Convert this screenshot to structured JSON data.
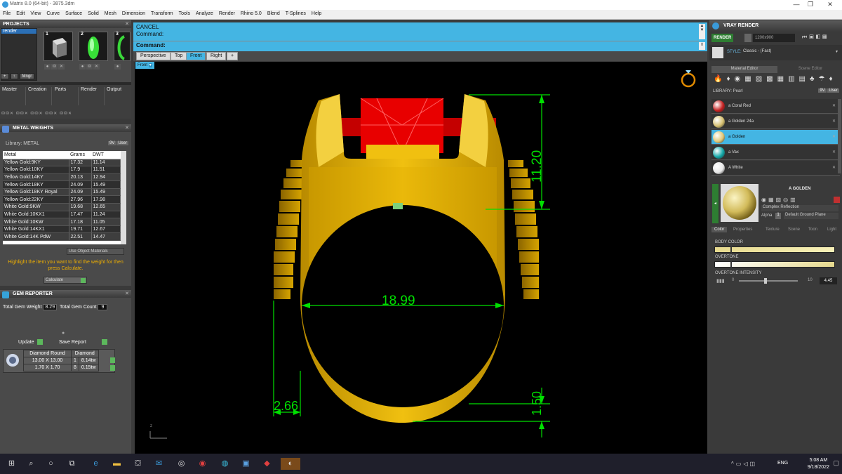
{
  "window": {
    "title": "Matrix 8.0 (64-bit) - 3875.3dm"
  },
  "menu": [
    "File",
    "Edit",
    "View",
    "Curve",
    "Surface",
    "Solid",
    "Mesh",
    "Dimension",
    "Transform",
    "Tools",
    "Analyze",
    "Render",
    "Rhino 5.0",
    "Blend",
    "T-Splines",
    "Help"
  ],
  "projects": {
    "title": "PROJECTS",
    "selected": "render",
    "thumbs": [
      "1",
      "2",
      "3"
    ],
    "tools": [
      "+",
      "↑",
      "Mngr"
    ]
  },
  "builder_tabs": [
    "Master",
    "Creation",
    "Parts",
    "Render",
    "Output"
  ],
  "metal_weights": {
    "title": "METAL WEIGHTS",
    "library": "Library: METAL",
    "lib_buttons": [
      "9V",
      "User"
    ],
    "columns": [
      "Metal",
      "Grams",
      "DWT"
    ],
    "rows": [
      [
        "Yellow Gold:9KY",
        "17.32",
        "11.14"
      ],
      [
        "Yellow Gold:10KY",
        "17.9",
        "11.51"
      ],
      [
        "Yellow Gold:14KY",
        "20.13",
        "12.94"
      ],
      [
        "Yellow Gold:18KY",
        "24.09",
        "15.49"
      ],
      [
        "Yellow Gold:18KY Royal",
        "24.09",
        "15.49"
      ],
      [
        "Yellow Gold:22KY",
        "27.96",
        "17.98"
      ],
      [
        "White Gold:9KW",
        "19.68",
        "12.65"
      ],
      [
        "White Gold:10KX1",
        "17.47",
        "11.24"
      ],
      [
        "White Gold:10KW",
        "17.18",
        "11.05"
      ],
      [
        "White Gold:14KX1",
        "19.71",
        "12.67"
      ],
      [
        "White Gold:14K PdW",
        "22.51",
        "14.47"
      ]
    ],
    "use_object": "Use Object Materials",
    "hint": "Highlight the item you want to find the weight for then press Calculate.",
    "calculate": "Calculate"
  },
  "gem_reporter": {
    "title": "GEM REPORTER",
    "total_weight_label": "Total Gem Weight",
    "total_weight": "8.29",
    "total_count_label": "Total Gem Count",
    "total_count": "9",
    "update": "Update",
    "save_report": "Save Report",
    "table": {
      "header": [
        "Diamond Round",
        "Diamond"
      ],
      "rows": [
        [
          "13.00 X 13.00",
          "1",
          "8.14tw"
        ],
        [
          "1.70 X 1.70",
          "8",
          "0.15tw"
        ]
      ]
    }
  },
  "command": {
    "line1": "CANCEL",
    "line2": "Command:",
    "prompt": "Command:"
  },
  "viewport_tabs": [
    "Perspective",
    "Top",
    "Front",
    "Right",
    "+"
  ],
  "active_viewport": "Front",
  "viewport_title": "Front",
  "dimensions": {
    "top_height": "11.20",
    "inner_diameter": "18.99",
    "shank_width": "2.66",
    "bottom_thickness": "1.50"
  },
  "vray": {
    "title": "VRAY RENDER",
    "render_btn": "RENDER",
    "resolution": "1200x900",
    "style_label": "STYLE:",
    "style_value": "Classic - (Fast)",
    "tabs": [
      "Material Editor",
      "Scene Editor"
    ],
    "library": "LIBRARY: Pearl",
    "lib_buttons": [
      "9V",
      "User"
    ],
    "materials": [
      {
        "name": "a Coral Red",
        "color": "#c42020"
      },
      {
        "name": "a Golden 24a",
        "color": "#d6c070"
      },
      {
        "name": "a Golden",
        "color": "#e0c878"
      },
      {
        "name": "a Vax",
        "color": "#12a8a8"
      },
      {
        "name": "A White",
        "color": "#e8e8e8"
      }
    ],
    "selected_material": "A GOLDEN",
    "reflection": "Complex Reflection",
    "alpha_label": "Alpha",
    "alpha_value": "1",
    "ground": "Default Ground Plane",
    "prop_tabs": [
      "Color",
      "Properties",
      "Texture",
      "Scene",
      "Toon",
      "Light"
    ],
    "body_color_label": "BODY COLOR",
    "overtone_label": "OVERTONE",
    "overtone_intensity_label": "OVERTONE INTENSITY",
    "intensity_min": "0",
    "intensity_max": "10",
    "intensity_value": "4.45"
  },
  "taskbar": {
    "lang": "ENG",
    "time": "5:08 AM",
    "date": "9/18/2022"
  }
}
